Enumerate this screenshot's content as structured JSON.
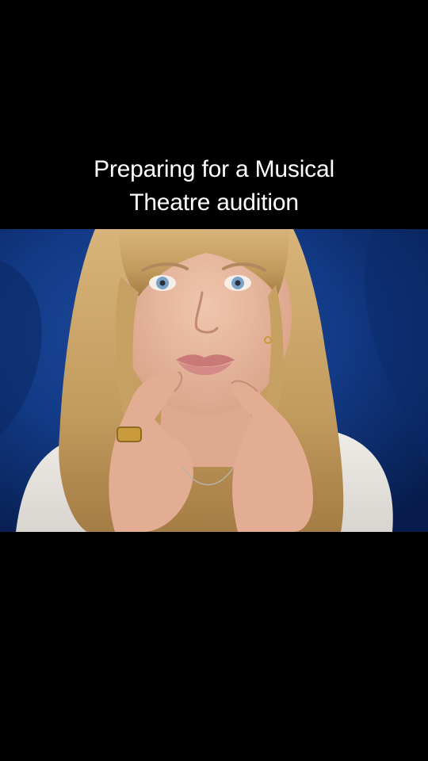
{
  "caption": {
    "line1": "Preparing for a Musical",
    "line2": "Theatre audition"
  },
  "colors": {
    "background": "#000000",
    "caption_text": "#ffffff",
    "backdrop_blue": "#123a86",
    "hair": "#c9a56a",
    "skin": "#e8b8a0",
    "shirt": "#e9e6e2",
    "lips": "#c97a78",
    "eyes": "#7aa2c8",
    "ring": "#c89a3a"
  }
}
